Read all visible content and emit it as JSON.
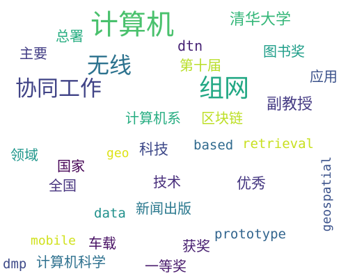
{
  "words": [
    {
      "text": "计算机",
      "color": "#4ac16d"
    },
    {
      "text": "清华大学",
      "color": "#35b779"
    },
    {
      "text": "总署",
      "color": "#27ad81"
    },
    {
      "text": "dtn",
      "color": "#482475"
    },
    {
      "text": "图书奖",
      "color": "#1f9e89"
    },
    {
      "text": "主要",
      "color": "#433e85"
    },
    {
      "text": "无线",
      "color": "#2c728e"
    },
    {
      "text": "第十届",
      "color": "#b8de29"
    },
    {
      "text": "应用",
      "color": "#3b528b"
    },
    {
      "text": "协同工作",
      "color": "#414487"
    },
    {
      "text": "组网",
      "color": "#22a884"
    },
    {
      "text": "副教授",
      "color": "#443a83"
    },
    {
      "text": "计算机系",
      "color": "#26ad81"
    },
    {
      "text": "区块链",
      "color": "#bddf26"
    },
    {
      "text": "领域",
      "color": "#1f968b"
    },
    {
      "text": "geo",
      "color": "#dde318"
    },
    {
      "text": "科技",
      "color": "#3e4989"
    },
    {
      "text": "based",
      "color": "#306a8e"
    },
    {
      "text": "retrieval",
      "color": "#c8e020"
    },
    {
      "text": "国家",
      "color": "#440154"
    },
    {
      "text": "全国",
      "color": "#46327e"
    },
    {
      "text": "技术",
      "color": "#472d7b"
    },
    {
      "text": "优秀",
      "color": "#453781"
    },
    {
      "text": "geospatial",
      "color": "#3b528b"
    },
    {
      "text": "data",
      "color": "#21918c"
    },
    {
      "text": "新闻出版",
      "color": "#2a788e"
    },
    {
      "text": "mobile",
      "color": "#d0e11c"
    },
    {
      "text": "车载",
      "color": "#471063"
    },
    {
      "text": "prototype",
      "color": "#32658e"
    },
    {
      "text": "获奖",
      "color": "#482071"
    },
    {
      "text": "dmp",
      "color": "#3e4a89"
    },
    {
      "text": "计算机科学",
      "color": "#2d708e"
    },
    {
      "text": "一等奖",
      "color": "#481a6c"
    }
  ]
}
